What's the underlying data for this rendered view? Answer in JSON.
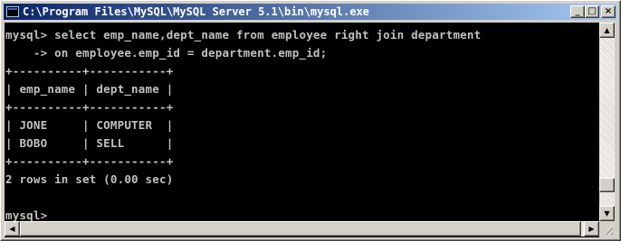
{
  "window": {
    "title": "C:\\Program Files\\MySQL\\MySQL Server 5.1\\bin\\mysql.exe",
    "minimize_label": "_",
    "maximize_label": "□",
    "close_label": "×"
  },
  "console": {
    "lines": [
      "mysql> select emp_name,dept_name from employee right join department",
      "    -> on employee.emp_id = department.emp_id;",
      "+----------+-----------+",
      "| emp_name | dept_name |",
      "+----------+-----------+",
      "| JONE     | COMPUTER  |",
      "| BOBO     | SELL      |",
      "+----------+-----------+",
      "2 rows in set (0.00 sec)",
      "",
      "mysql>"
    ]
  },
  "scrollbars": {
    "up_arrow": "▲",
    "down_arrow": "▼",
    "left_arrow": "◀",
    "right_arrow": "▶"
  }
}
